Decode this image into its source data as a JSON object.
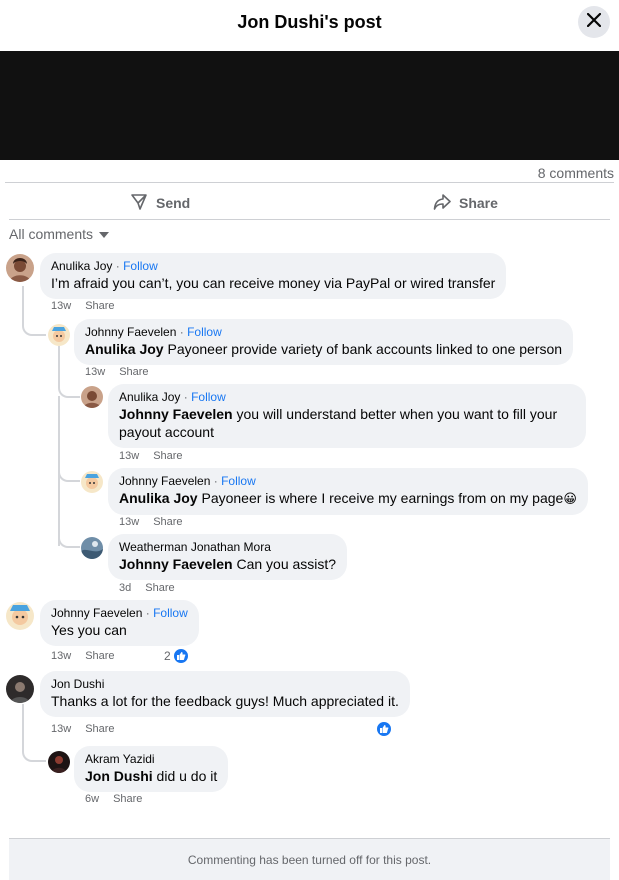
{
  "header": {
    "title": "Jon Dushi's post"
  },
  "stats": {
    "comments": "8 comments"
  },
  "actions": {
    "send": "Send",
    "share": "Share"
  },
  "sort": {
    "label": "All comments"
  },
  "colors": {
    "accent": "#1877f2",
    "bubble": "#f0f2f5",
    "muted": "#65676b"
  },
  "comments": [
    {
      "author": "Anulika Joy",
      "follow": "Follow",
      "text": "I’m afraid you can’t, you can receive money via PayPal or wired transfer",
      "time": "13w",
      "share": "Share"
    },
    {
      "author": "Johnny Faevelen",
      "follow": "Follow",
      "mention": "Anulika Joy",
      "text": " Payoneer provide variety of bank accounts linked to one person",
      "time": "13w",
      "share": "Share"
    },
    {
      "author": "Anulika Joy",
      "follow": "Follow",
      "mention": "Johnny Faevelen",
      "text": " you will understand better when you want to fill your payout account",
      "time": "13w",
      "share": "Share"
    },
    {
      "author": "Johnny Faevelen",
      "follow": "Follow",
      "mention": "Anulika Joy",
      "text": " Payoneer is where I receive my earnings from on my page",
      "emoji": "😀",
      "time": "13w",
      "share": "Share"
    },
    {
      "author": "Weatherman Jonathan Mora",
      "mention": "Johnny Faevelen",
      "text": " Can you assist?",
      "time": "3d",
      "share": "Share"
    },
    {
      "author": "Johnny Faevelen",
      "follow": "Follow",
      "text": "Yes you can",
      "time": "13w",
      "share": "Share",
      "reactions": "2",
      "reaction_icon": "like-icon"
    },
    {
      "author": "Jon Dushi",
      "text": "Thanks a lot for the feedback guys! Much appreciated it.",
      "time": "13w",
      "share": "Share",
      "reaction_icon": "like-icon"
    },
    {
      "author": "Akram Yazidi",
      "mention": "Jon Dushi",
      "text": " did u do it",
      "time": "6w",
      "share": "Share"
    }
  ],
  "footer": {
    "notice": "Commenting has been turned off for this post."
  }
}
